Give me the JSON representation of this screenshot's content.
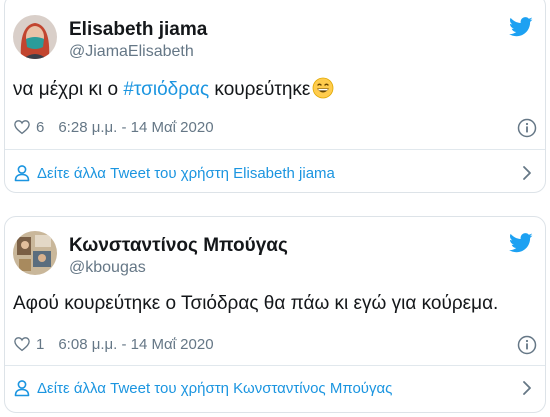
{
  "tweets": [
    {
      "name": "Elisabeth jiama",
      "handle": "@JiamaElisabeth",
      "text_before": "να μέχρι κι ο ",
      "hashtag": "#τσιόδρας",
      "text_after": " κουρεύτηκε",
      "emoji_icon": "grinning-face-emoji",
      "likes": "6",
      "timestamp": "6:28 μ.μ. - 14 Μαΐ 2020",
      "more_label": "Δείτε άλλα Tweet του χρήστη Elisabeth jiama"
    },
    {
      "name": "Κωνσταντίνος Μπούγας",
      "handle": "@kbougas",
      "text": "Αφού κουρεύτηκε ο Τσιόδρας θα πάω κι εγώ για κούρεμα.",
      "likes": "1",
      "timestamp": "6:08 μ.μ. - 14 Μαΐ 2020",
      "more_label": "Δείτε άλλα Tweet του χρήστη Κωνσταντίνος Μπούγας"
    }
  ],
  "colors": {
    "link": "#1b95e0",
    "twitter_blue": "#1da1f2",
    "secondary_text": "#657786",
    "border": "#dde3e8"
  },
  "icons": [
    "twitter-bird-icon",
    "heart-icon",
    "info-icon",
    "person-icon",
    "chevron-right-icon"
  ]
}
